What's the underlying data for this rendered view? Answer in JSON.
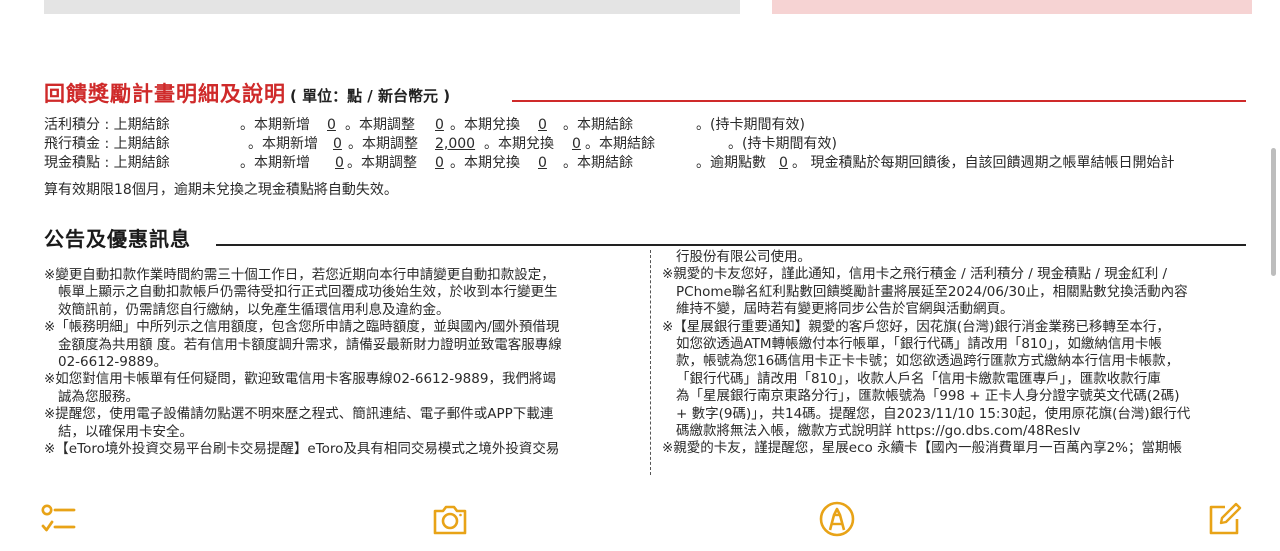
{
  "reward_section": {
    "title": "回饋獎勵計畫明細及說明",
    "unit": "( 單位：點 / 新台幣元 )",
    "rows": [
      {
        "name": "活利積分 : 上期結餘",
        "new_label": "。本期新增",
        "new": "0",
        "adj_label": "。本期調整",
        "adj": "0",
        "redeem_label": "。本期兌換",
        "redeem": "0",
        "bal_label": "。本期結餘",
        "note": "。(持卡期間有效)"
      },
      {
        "name": "飛行積金 : 上期結餘",
        "new_label": "。本期新增",
        "new": "0",
        "adj_label": "。本期調整",
        "adj": "2,000",
        "redeem_label": "。本期兌換",
        "redeem": "0",
        "bal_label": "。本期結餘",
        "note": "。(持卡期間有效)"
      },
      {
        "name": "現金積點 : 上期結餘",
        "new_label": "。本期新增",
        "new": "0",
        "adj_label": "。本期調整",
        "adj": "0",
        "redeem_label": "。本期兌換",
        "redeem": "0",
        "bal_label": "。本期結餘",
        "note": "。逾期點數",
        "note_value": "0",
        "note_tail": "。 現金積點於每期回饋後，自該回饋週期之帳單結帳日開始計"
      }
    ],
    "wrap_tail": "算有效期限18個月，逾期未兌換之現金積點將自動失效。"
  },
  "notice_section": {
    "title": "公告及優惠訊息",
    "left_column": [
      {
        "text": "※變更自動扣款作業時間約需三十個工作日，若您近期向本行申請變更自動扣款設定，",
        "cont": false
      },
      {
        "text": "帳單上顯示之自動扣款帳戶仍需待受扣行正式回覆成功後始生效，於收到本行變更生",
        "cont": true
      },
      {
        "text": "效簡訊前，仍需請您自行繳納，以免產生循環信用利息及違約金。",
        "cont": true
      },
      {
        "text": "※「帳務明細」中所列示之信用額度，包含您所申請之臨時額度，並與國內/國外預借現",
        "cont": false
      },
      {
        "text": "金額度為共用額 度。若有信用卡額度調升需求，請備妥最新財力證明並致電客服專線",
        "cont": true
      },
      {
        "text": "02-6612-9889。",
        "cont": true
      },
      {
        "text": "※如您對信用卡帳單有任何疑問，歡迎致電信用卡客服專線02-6612-9889，我們將竭",
        "cont": false
      },
      {
        "text": "誠為您服務。",
        "cont": true
      },
      {
        "text": "※提醒您，使用電子設備請勿點選不明來歷之程式、簡訊連結、電子郵件或APP下載連",
        "cont": false
      },
      {
        "text": "結，以確保用卡安全。",
        "cont": true
      },
      {
        "text": "※【eToro境外投資交易平台刷卡交易提醒】eToro及具有相同交易模式之境外投資交易",
        "cont": false
      }
    ],
    "right_column": [
      {
        "text": "行股份有限公司使用。",
        "cont": true
      },
      {
        "text": "※親愛的卡友您好，謹此通知，信用卡之飛行積金 / 活利積分 / 現金積點 / 現金紅利 /",
        "cont": false
      },
      {
        "text": "PChome聯名紅利點數回饋獎勵計畫將展延至2024/06/30止，相關點數兌換活動內容",
        "cont": true
      },
      {
        "text": "維持不變，屆時若有變更將同步公告於官網與活動網頁。",
        "cont": true
      },
      {
        "text": "※【星展銀行重要通知】親愛的客戶您好，因花旗(台灣)銀行消金業務已移轉至本行，",
        "cont": false
      },
      {
        "text": "如您欲透過ATM轉帳繳付本行帳單，「銀行代碼」請改用「810」，如繳納信用卡帳",
        "cont": true
      },
      {
        "text": "款，帳號為您16碼信用卡正卡卡號；如您欲透過跨行匯款方式繳納本行信用卡帳款，",
        "cont": true
      },
      {
        "text": "「銀行代碼」請改用「810」，收款人戶名「信用卡繳款電匯專戶」，匯款收款行庫",
        "cont": true
      },
      {
        "text": "為「星展銀行南京東路分行」，匯款帳號為「998 + 正卡人身分證字號英文代碼(2碼)",
        "cont": true
      },
      {
        "text": "+ 數字(9碼)」，共14碼。提醒您，自2023/11/10 15:30起，使用原花旗(台灣)銀行代",
        "cont": true
      },
      {
        "text": "碼繳款將無法入帳，繳款方式說明詳 https://go.dbs.com/48Reslv",
        "cont": true
      },
      {
        "text": "※親愛的卡友，謹提醒您，星展eco 永續卡【國內一般消費單月一百萬內享2%；當期帳",
        "cont": false
      }
    ]
  },
  "toolbar": {
    "buttons": [
      "checklist-icon",
      "camera-icon",
      "highlighter-icon",
      "edit-icon"
    ],
    "accent_color": "#e8a317"
  },
  "colors": {
    "section_red": "#cf2a2a",
    "text": "#2a2a2a"
  }
}
